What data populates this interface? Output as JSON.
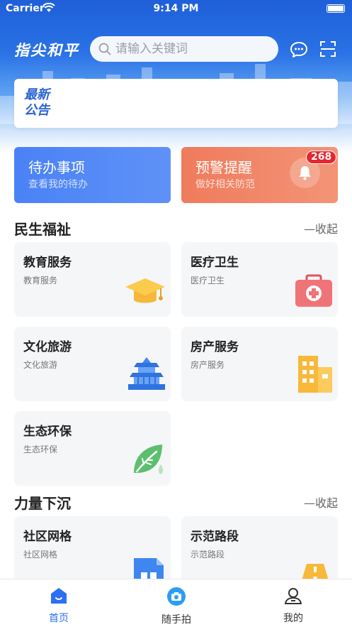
{
  "status_bar": {
    "carrier": "Carrier",
    "time": "9:14 PM"
  },
  "header": {
    "logo": "指尖和平",
    "search_placeholder": "请输入关键词"
  },
  "notice": {
    "label": "最新公告"
  },
  "quick_cards": [
    {
      "title": "待办事项",
      "subtitle": "查看我的待办"
    },
    {
      "title": "预警提醒",
      "subtitle": "做好相关防范",
      "badge": "268"
    }
  ],
  "sections": [
    {
      "title": "民生福祉",
      "toggle": "—收起",
      "items": [
        {
          "title": "教育服务",
          "subtitle": "教育服务",
          "icon": "graduation-cap-icon"
        },
        {
          "title": "医疗卫生",
          "subtitle": "医疗卫生",
          "icon": "medical-kit-icon"
        },
        {
          "title": "文化旅游",
          "subtitle": "文化旅游",
          "icon": "temple-icon"
        },
        {
          "title": "房产服务",
          "subtitle": "房产服务",
          "icon": "buildings-icon"
        },
        {
          "title": "生态环保",
          "subtitle": "生态环保",
          "icon": "leaf-icon"
        }
      ]
    },
    {
      "title": "力量下沉",
      "toggle": "—收起",
      "items": [
        {
          "title": "社区网格",
          "subtitle": "社区网格",
          "icon": "grid-document-icon"
        },
        {
          "title": "示范路段",
          "subtitle": "示范路段",
          "icon": "road-icon"
        }
      ]
    }
  ],
  "tabbar": [
    {
      "label": "首页",
      "icon": "home-icon",
      "active": true
    },
    {
      "label": "随手拍",
      "icon": "camera-icon",
      "active": false
    },
    {
      "label": "我的",
      "icon": "user-icon",
      "active": false
    }
  ],
  "colors": {
    "primary": "#2d6ff2",
    "todo": "#4a82f6",
    "alert": "#ef7b5c",
    "badge": "#e8262e"
  }
}
